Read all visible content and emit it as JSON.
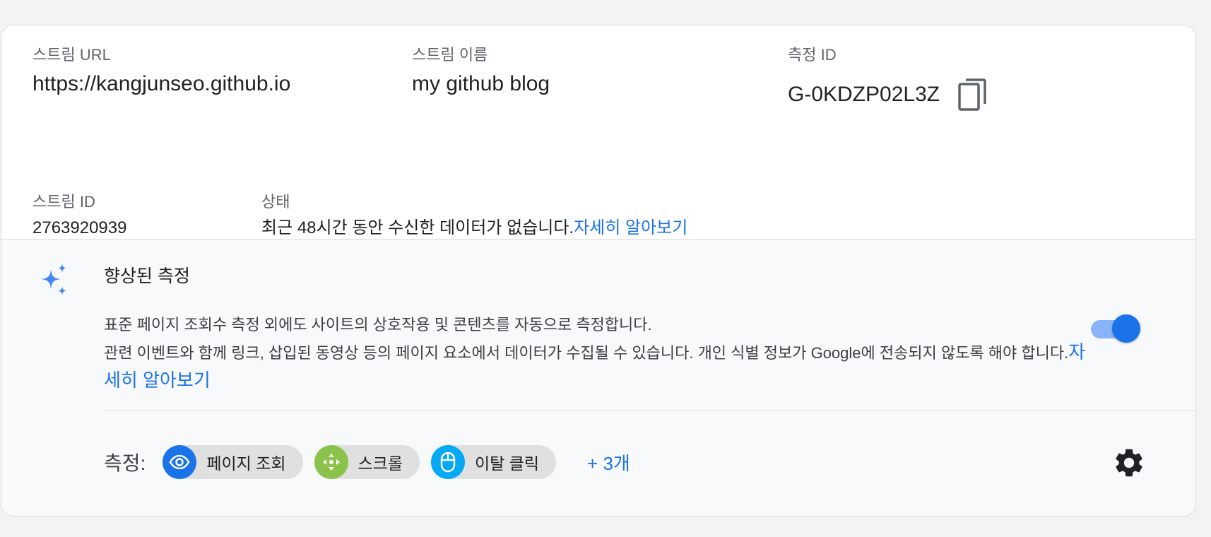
{
  "stream": {
    "url_label": "스트림 URL",
    "url_value": "https://kangjunseo.github.io",
    "name_label": "스트림 이름",
    "name_value": "my github blog",
    "measurement_id_label": "측정 ID",
    "measurement_id_value": "G-0KDZP02L3Z",
    "stream_id_label": "스트림 ID",
    "stream_id_value": "2763920939",
    "status_label": "상태",
    "status_text": "최근 48시간 동안 수신한 데이터가 없습니다.",
    "status_link": "자세히 알아보기"
  },
  "enhanced": {
    "title": "향상된 측정",
    "desc_line1": "표준 페이지 조회수 측정 외에도 사이트의 상호작용 및 콘텐츠를 자동으로 측정합니다.",
    "desc_line2": "관련 이벤트와 함께 링크, 삽입된 동영상 등의 페이지 요소에서 데이터가 수집될 수 있습니다. 개인 식별 정보가 Google에 전송되지 않도록 해야 합니다.",
    "learn_more": "자세히 알아보기",
    "toggle_on": true,
    "measures_label": "측정:",
    "chips": [
      {
        "label": "페이지 조회",
        "icon": "eye-icon",
        "color": "#1a73e8"
      },
      {
        "label": "스크롤",
        "icon": "scroll-arrows-icon",
        "color": "#8bc34a"
      },
      {
        "label": "이탈 클릭",
        "icon": "mouse-icon",
        "color": "#03a9f4"
      }
    ],
    "more": "+ 3개"
  },
  "colors": {
    "accent": "#1a73e8",
    "link": "#1a73e8",
    "sparkle": "#4285f4"
  }
}
